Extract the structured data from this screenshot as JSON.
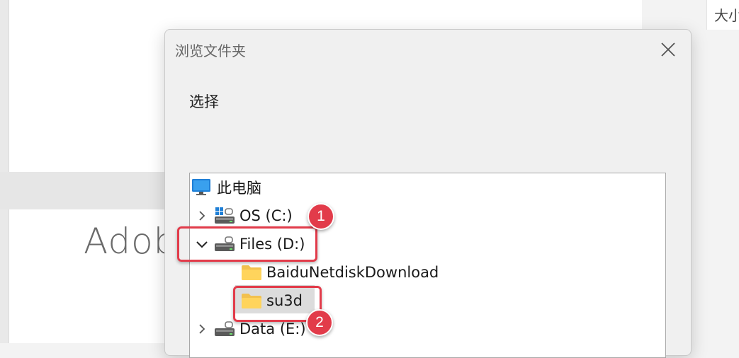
{
  "background": {
    "app_title_fragment": "Adob",
    "right_pane_fragment": "大小"
  },
  "dialog": {
    "title": "浏览文件夹",
    "instruction": "选择",
    "close_icon": "close-icon"
  },
  "tree": {
    "nodes": [
      {
        "label": "此电脑",
        "icon": "computer-icon",
        "expander": "none"
      },
      {
        "label": "OS (C:)",
        "icon": "system-drive-icon",
        "expander": "collapsed"
      },
      {
        "label": "Files (D:)",
        "icon": "drive-icon",
        "expander": "expanded"
      },
      {
        "label": "BaiduNetdiskDownload",
        "icon": "folder-icon",
        "expander": "none"
      },
      {
        "label": "su3d",
        "icon": "folder-icon",
        "expander": "none",
        "selected": true
      },
      {
        "label": "Data (E:)",
        "icon": "drive-icon",
        "expander": "collapsed"
      }
    ]
  },
  "annotations": {
    "step1": "1",
    "step2": "2",
    "color": "#e23b4a"
  }
}
